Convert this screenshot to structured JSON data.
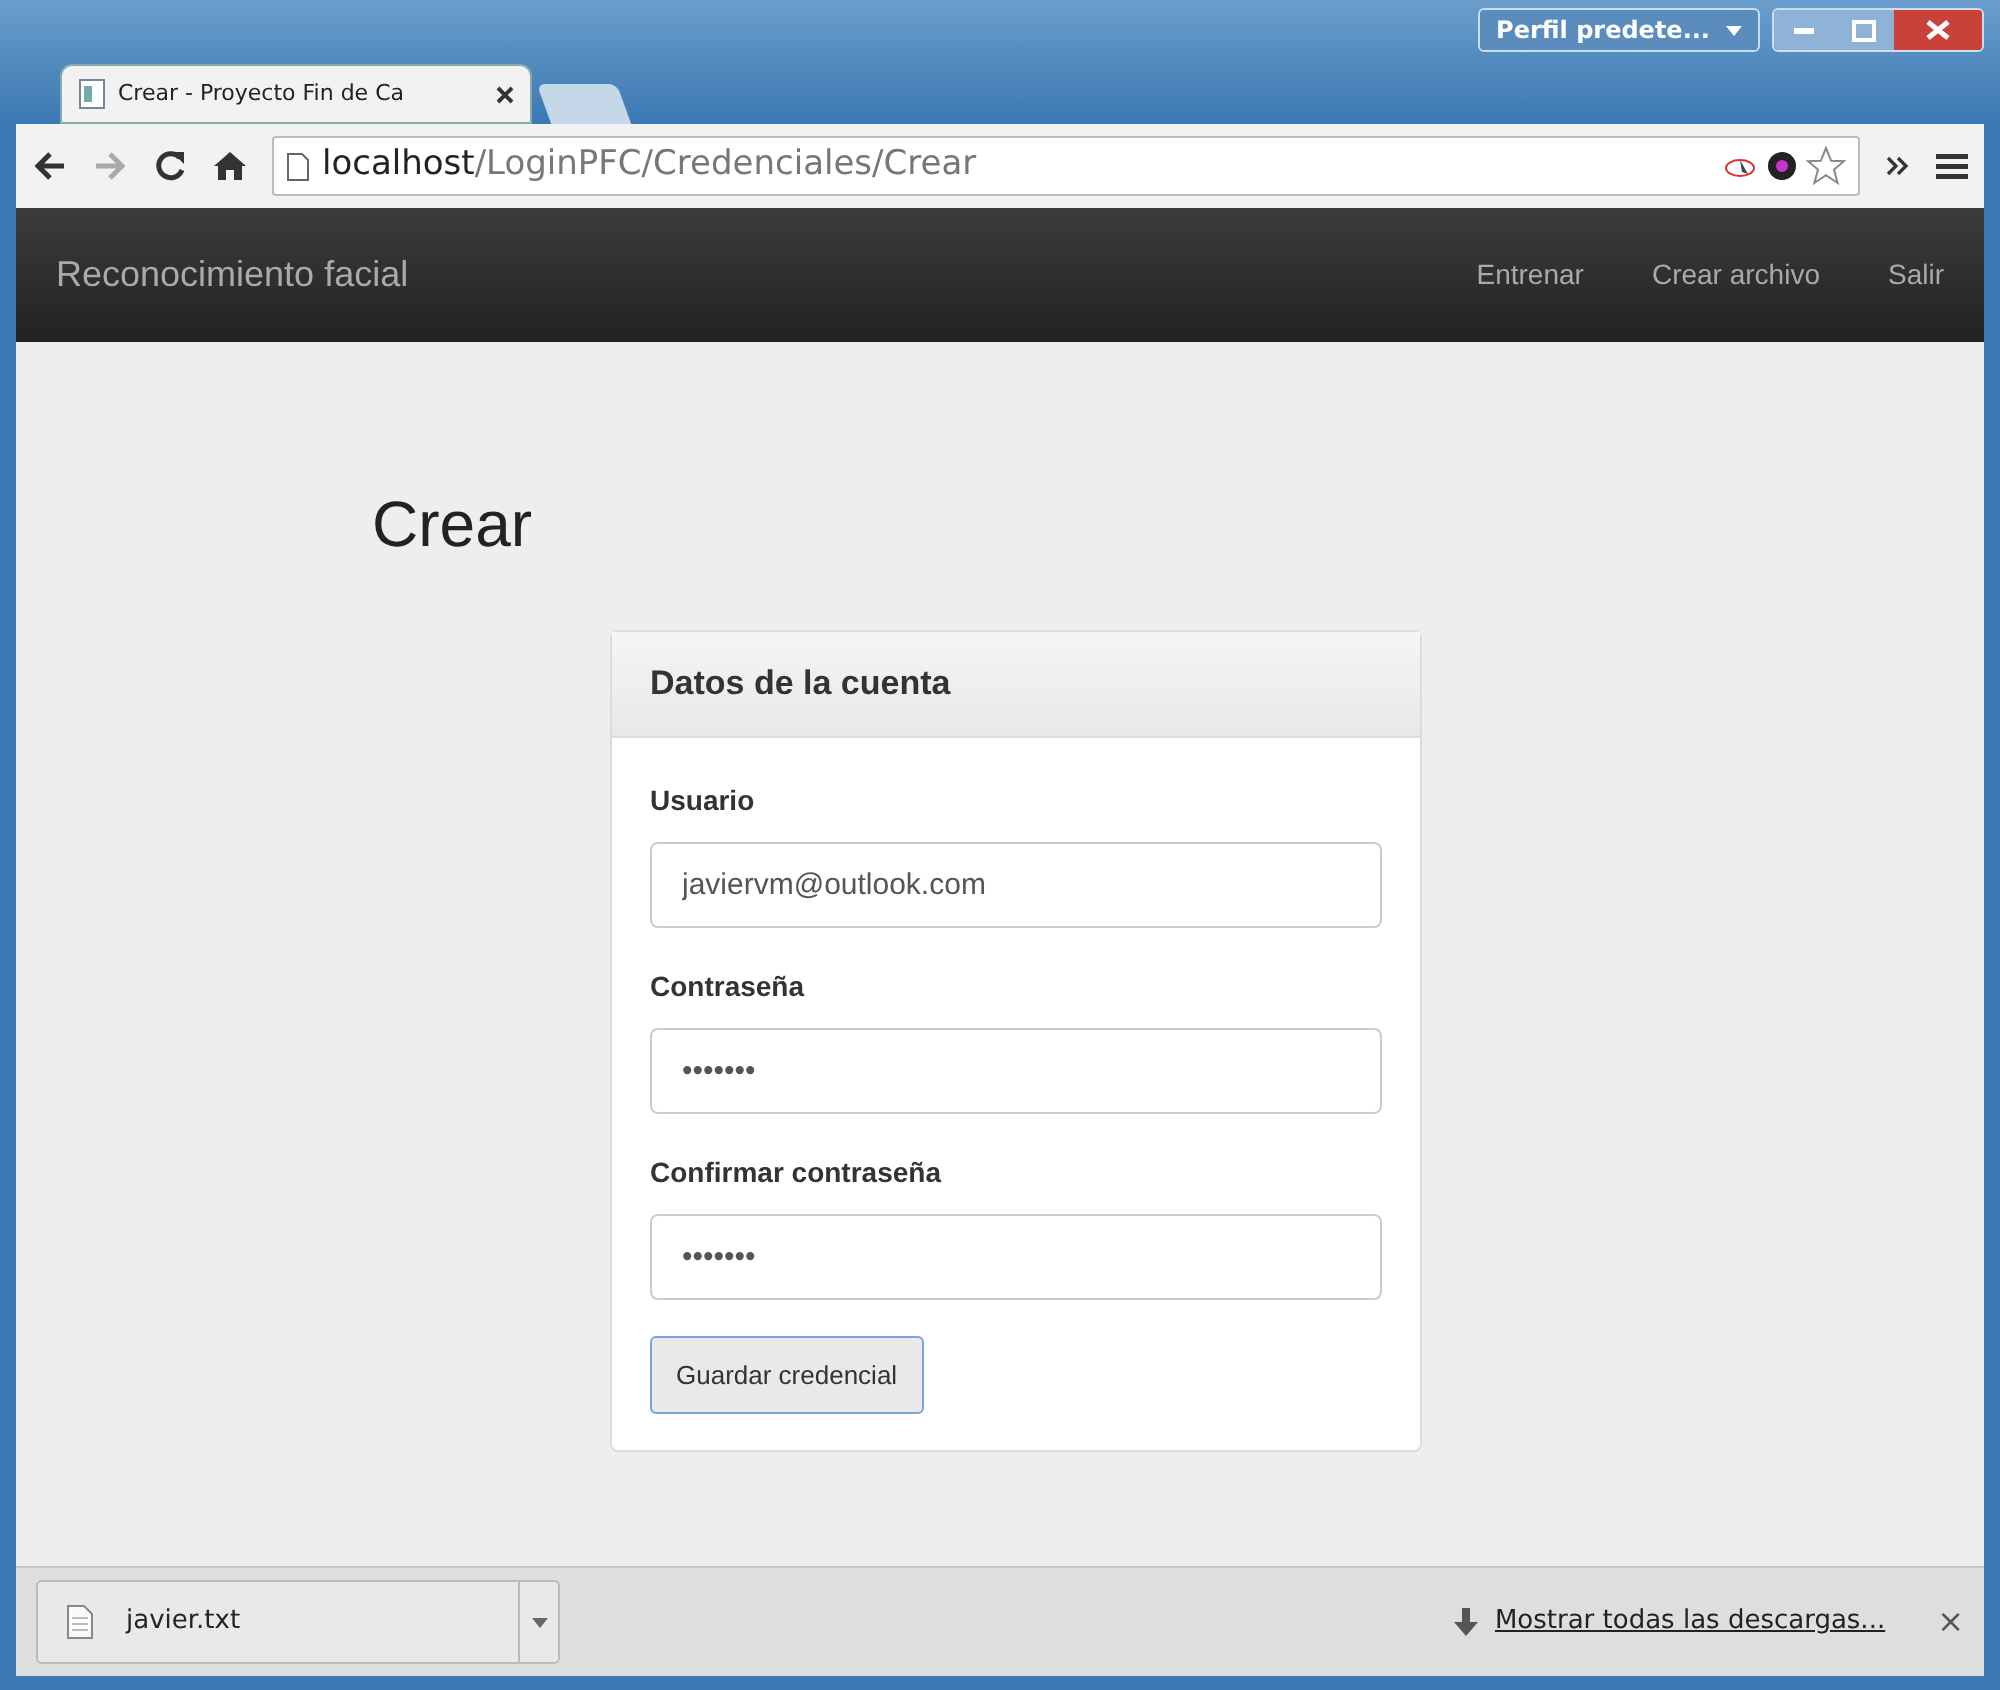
{
  "window": {
    "profile_button": "Perfil predete..."
  },
  "tabs": [
    {
      "label": "Crear - Proyecto Fin de Ca",
      "selected": true
    }
  ],
  "address_bar": {
    "host": "localhost",
    "path": "/LoginPFC/Credenciales/Crear"
  },
  "navbar": {
    "brand": "Reconocimiento facial",
    "links": [
      "Entrenar",
      "Crear archivo",
      "Salir"
    ]
  },
  "page": {
    "title": "Crear",
    "panel": {
      "heading": "Datos de la cuenta",
      "fields": [
        {
          "label": "Usuario",
          "value": "javiervm@outlook.com"
        },
        {
          "label": "Contraseña",
          "value": "•••••••"
        },
        {
          "label": "Confirmar contraseña",
          "value": "•••••••"
        }
      ],
      "button": "Guardar credencial"
    }
  },
  "download_bar": {
    "file": "javier.txt",
    "show_all": "Mostrar todas las descargas...",
    "close": "×"
  }
}
